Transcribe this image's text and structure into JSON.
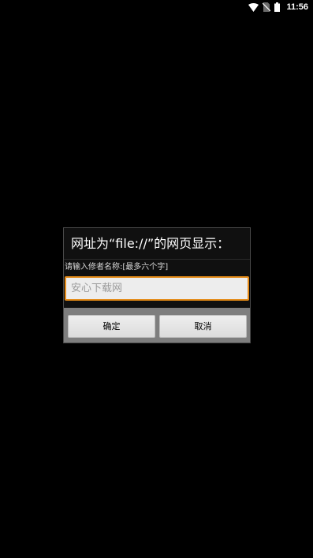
{
  "status_bar": {
    "time": "11:56",
    "icons": [
      "wifi-icon",
      "no-sim-icon",
      "battery-icon"
    ]
  },
  "dialog": {
    "title": "网址为“file://”的网页显示：",
    "message": "请输入修者名称:[最多六个字]",
    "input": {
      "value": "",
      "placeholder": "安心下载网"
    },
    "buttons": {
      "ok_label": "确定",
      "cancel_label": "取消"
    }
  },
  "colors": {
    "background": "#000000",
    "dialog_background": "#101010",
    "input_focus_border": "#e48a17",
    "button_bar": "#7e7e7e"
  }
}
